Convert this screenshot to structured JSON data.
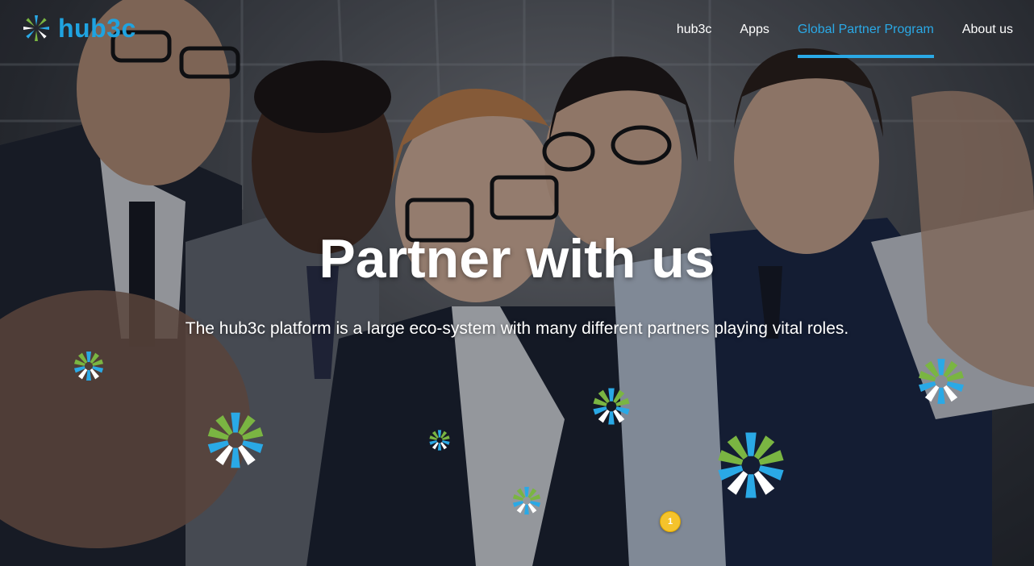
{
  "brand": {
    "name": "hub3c",
    "accent": "#2aa9e6",
    "green": "#7ab542"
  },
  "nav": {
    "items": [
      {
        "label": "hub3c",
        "active": false
      },
      {
        "label": "Apps",
        "active": false
      },
      {
        "label": "Global Partner Program",
        "active": true
      },
      {
        "label": "About us",
        "active": false
      }
    ]
  },
  "hero": {
    "title": "Partner with us",
    "subtitle": "The hub3c platform is a large eco-system with many different partners playing vital roles."
  },
  "notification_badge": "1"
}
